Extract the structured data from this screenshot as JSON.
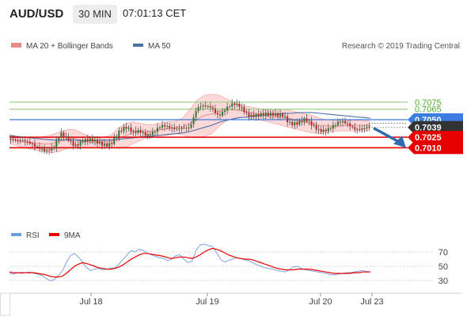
{
  "header": {
    "pair": "AUD/USD",
    "interval": "30 MIN",
    "time": "07:01:13 CET"
  },
  "legend": {
    "ma20_bb": "MA 20 + Bollinger Bands",
    "ma50": "MA 50",
    "copyright": "Research © 2019 Trading Central"
  },
  "colors": {
    "bollinger_fill": "#fcd2d2",
    "bollinger_edge": "#f19a9a",
    "ma20": "#ea8a8a",
    "ma50": "#4a6fa5",
    "target_line": "#9fd08a",
    "target_label": "#4caf2a",
    "pivot": "#3b7de0",
    "support": "#e60000",
    "last_price": "#333333",
    "candle_up": "#2e7d32",
    "candle_down": "#c62828",
    "arrow": "#2f6bb0",
    "rsi": "#6f9be0",
    "rsi_ma": "#e60000"
  },
  "chart_data": [
    {
      "type": "candlestick",
      "series": [
        {
          "name": "MA 20 + Bollinger Bands"
        },
        {
          "name": "MA 50"
        }
      ],
      "x_ticks": [
        "Jul 18",
        "Jul 19",
        "Jul 20",
        "Jul 23"
      ],
      "ylim": [
        0.7,
        0.71
      ],
      "grid": false,
      "legend_position": "top-left",
      "price_path": [
        0.7022,
        0.7016,
        0.7017,
        0.7018,
        0.7014,
        0.7005,
        0.7006,
        0.7028,
        0.7025,
        0.7017,
        0.7019,
        0.7017,
        0.7016,
        0.7017,
        0.702,
        0.7031,
        0.7035,
        0.703,
        0.7037,
        0.7032,
        0.7032,
        0.7037,
        0.7037,
        0.704,
        0.7043,
        0.7038,
        0.7062,
        0.7068,
        0.7071,
        0.7059,
        0.7065,
        0.7068,
        0.7067,
        0.706,
        0.706,
        0.7057,
        0.7053,
        0.7055,
        0.706,
        0.7048,
        0.7044,
        0.7046,
        0.7041,
        0.7038,
        0.7039,
        0.704,
        0.7043,
        0.7042,
        0.704,
        0.7041,
        0.7039
      ],
      "bollinger_upper": [
        0.7029,
        0.7026,
        0.7024,
        0.7024,
        0.7025,
        0.7026,
        0.7029,
        0.7033,
        0.7036,
        0.7036,
        0.7031,
        0.7026,
        0.7024,
        0.7025,
        0.7028,
        0.7037,
        0.7044,
        0.7047,
        0.7045,
        0.7043,
        0.7043,
        0.7046,
        0.7047,
        0.7048,
        0.7052,
        0.7065,
        0.7078,
        0.7085,
        0.7086,
        0.7085,
        0.708,
        0.7075,
        0.7071,
        0.7069,
        0.7067,
        0.7065,
        0.7062,
        0.7064,
        0.7065,
        0.7063,
        0.706,
        0.7058,
        0.7056,
        0.7052,
        0.705,
        0.7049,
        0.7048,
        0.7049,
        0.7049,
        0.7049,
        0.7048
      ],
      "bollinger_lower": [
        0.7016,
        0.7013,
        0.701,
        0.7008,
        0.7006,
        0.7004,
        0.7003,
        0.7005,
        0.7009,
        0.7012,
        0.7011,
        0.701,
        0.701,
        0.7012,
        0.7011,
        0.7009,
        0.701,
        0.7015,
        0.702,
        0.7024,
        0.7025,
        0.7026,
        0.7028,
        0.703,
        0.7028,
        0.7025,
        0.7024,
        0.7026,
        0.703,
        0.704,
        0.7048,
        0.7052,
        0.7054,
        0.7052,
        0.705,
        0.7049,
        0.7046,
        0.7044,
        0.7041,
        0.7038,
        0.7036,
        0.7033,
        0.7031,
        0.703,
        0.7031,
        0.7033,
        0.7034,
        0.7034,
        0.7034,
        0.7034,
        0.7034
      ],
      "ma20": [
        0.7023,
        0.702,
        0.7018,
        0.7017,
        0.7016,
        0.7015,
        0.7016,
        0.7019,
        0.7022,
        0.7023,
        0.7021,
        0.7018,
        0.7017,
        0.7018,
        0.7019,
        0.7023,
        0.7027,
        0.7031,
        0.7033,
        0.7033,
        0.7034,
        0.7036,
        0.7037,
        0.7039,
        0.704,
        0.7045,
        0.7051,
        0.7056,
        0.7058,
        0.7062,
        0.7064,
        0.7064,
        0.7063,
        0.7061,
        0.7059,
        0.7057,
        0.7054,
        0.7054,
        0.7053,
        0.7051,
        0.7048,
        0.7046,
        0.7044,
        0.7042,
        0.7041,
        0.7041,
        0.7041,
        0.7042,
        0.7042,
        0.7042,
        0.7041
      ],
      "ma50": [
        0.7027,
        0.7026,
        0.7025,
        0.7024,
        0.7023,
        0.7022,
        0.7021,
        0.7021,
        0.7021,
        0.7021,
        0.702,
        0.702,
        0.702,
        0.7021,
        0.7021,
        0.7022,
        0.7023,
        0.7024,
        0.7025,
        0.7026,
        0.7027,
        0.7028,
        0.7029,
        0.703,
        0.7031,
        0.7033,
        0.7036,
        0.7039,
        0.7042,
        0.7046,
        0.7049,
        0.7051,
        0.7053,
        0.7054,
        0.7055,
        0.7056,
        0.7057,
        0.7058,
        0.7059,
        0.7059,
        0.706,
        0.706,
        0.706,
        0.7059,
        0.7058,
        0.7057,
        0.7056,
        0.7055,
        0.7054,
        0.7053,
        0.7052
      ],
      "horizontal_levels": [
        {
          "value": 0.7075,
          "label": "0.7075",
          "kind": "target"
        },
        {
          "value": 0.7065,
          "label": "0.7065",
          "kind": "target"
        },
        {
          "value": 0.705,
          "label": "0.7050",
          "kind": "pivot"
        },
        {
          "value": 0.7039,
          "label": "0.7039",
          "kind": "last"
        },
        {
          "value": 0.7025,
          "label": "0.7025",
          "kind": "support"
        },
        {
          "value": 0.701,
          "label": "0.7010",
          "kind": "support"
        }
      ],
      "arrow": {
        "from": 0.7038,
        "to": 0.7011,
        "direction": "down"
      }
    },
    {
      "type": "line",
      "series": [
        {
          "name": "RSI",
          "values": [
            40,
            39,
            41,
            40,
            41,
            42,
            40,
            39,
            37,
            33,
            30,
            31,
            37,
            43,
            55,
            65,
            68,
            63,
            56,
            48,
            44,
            46,
            47,
            45,
            46,
            47,
            48,
            53,
            60,
            66,
            72,
            70,
            74,
            72,
            68,
            66,
            64,
            62,
            61,
            58,
            60,
            65,
            66,
            60,
            55,
            57,
            72,
            80,
            81,
            79,
            78,
            70,
            60,
            56,
            58,
            60,
            62,
            61,
            59,
            58,
            55,
            52,
            50,
            48,
            47,
            46,
            44,
            43,
            42,
            45,
            49,
            50,
            47,
            45,
            44,
            43,
            42,
            41,
            40,
            38,
            38,
            39,
            40,
            41,
            41,
            42,
            43,
            44,
            43,
            42
          ]
        },
        {
          "name": "9MA",
          "values": [
            42,
            41,
            41,
            41,
            41,
            41,
            41,
            40,
            39,
            38,
            36,
            35,
            35,
            36,
            40,
            45,
            50,
            53,
            55,
            54,
            52,
            50,
            48,
            47,
            46,
            46,
            47,
            49,
            52,
            56,
            60,
            63,
            66,
            68,
            68,
            67,
            66,
            65,
            64,
            62,
            61,
            62,
            63,
            63,
            62,
            61,
            63,
            66,
            70,
            73,
            75,
            74,
            72,
            69,
            66,
            64,
            62,
            61,
            60,
            60,
            59,
            57,
            55,
            53,
            51,
            49,
            47,
            46,
            45,
            45,
            45,
            46,
            46,
            46,
            46,
            45,
            44,
            43,
            42,
            41,
            40,
            40,
            40,
            40,
            40,
            41,
            41,
            42,
            42,
            42
          ]
        }
      ],
      "yticks": [
        30,
        50,
        70
      ],
      "ylim": [
        20,
        85
      ],
      "x_ticks": [
        "Jul 18",
        "Jul 19",
        "Jul 20",
        "Jul 23"
      ],
      "legend_position": "top-left"
    }
  ]
}
